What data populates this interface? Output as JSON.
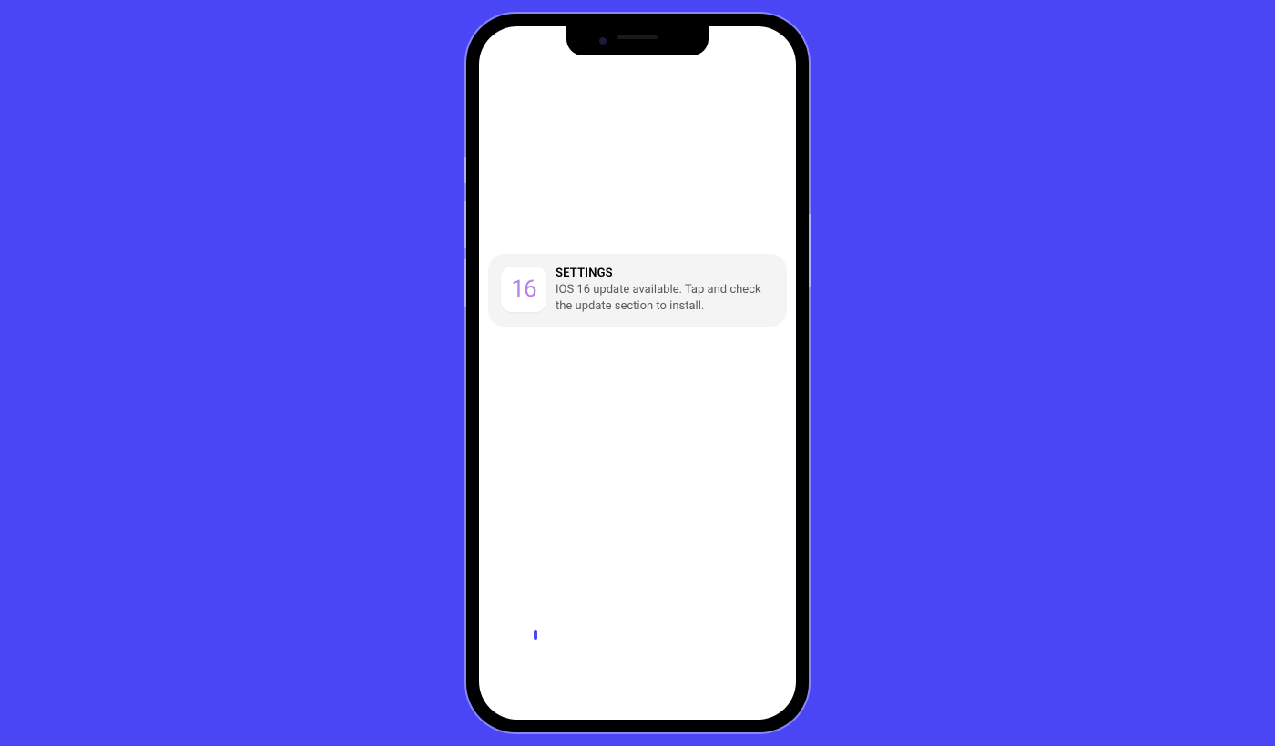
{
  "notification": {
    "icon_text": "16",
    "title": "SETTINGS",
    "message": "IOS 16 update available. Tap and check the update section to install."
  }
}
